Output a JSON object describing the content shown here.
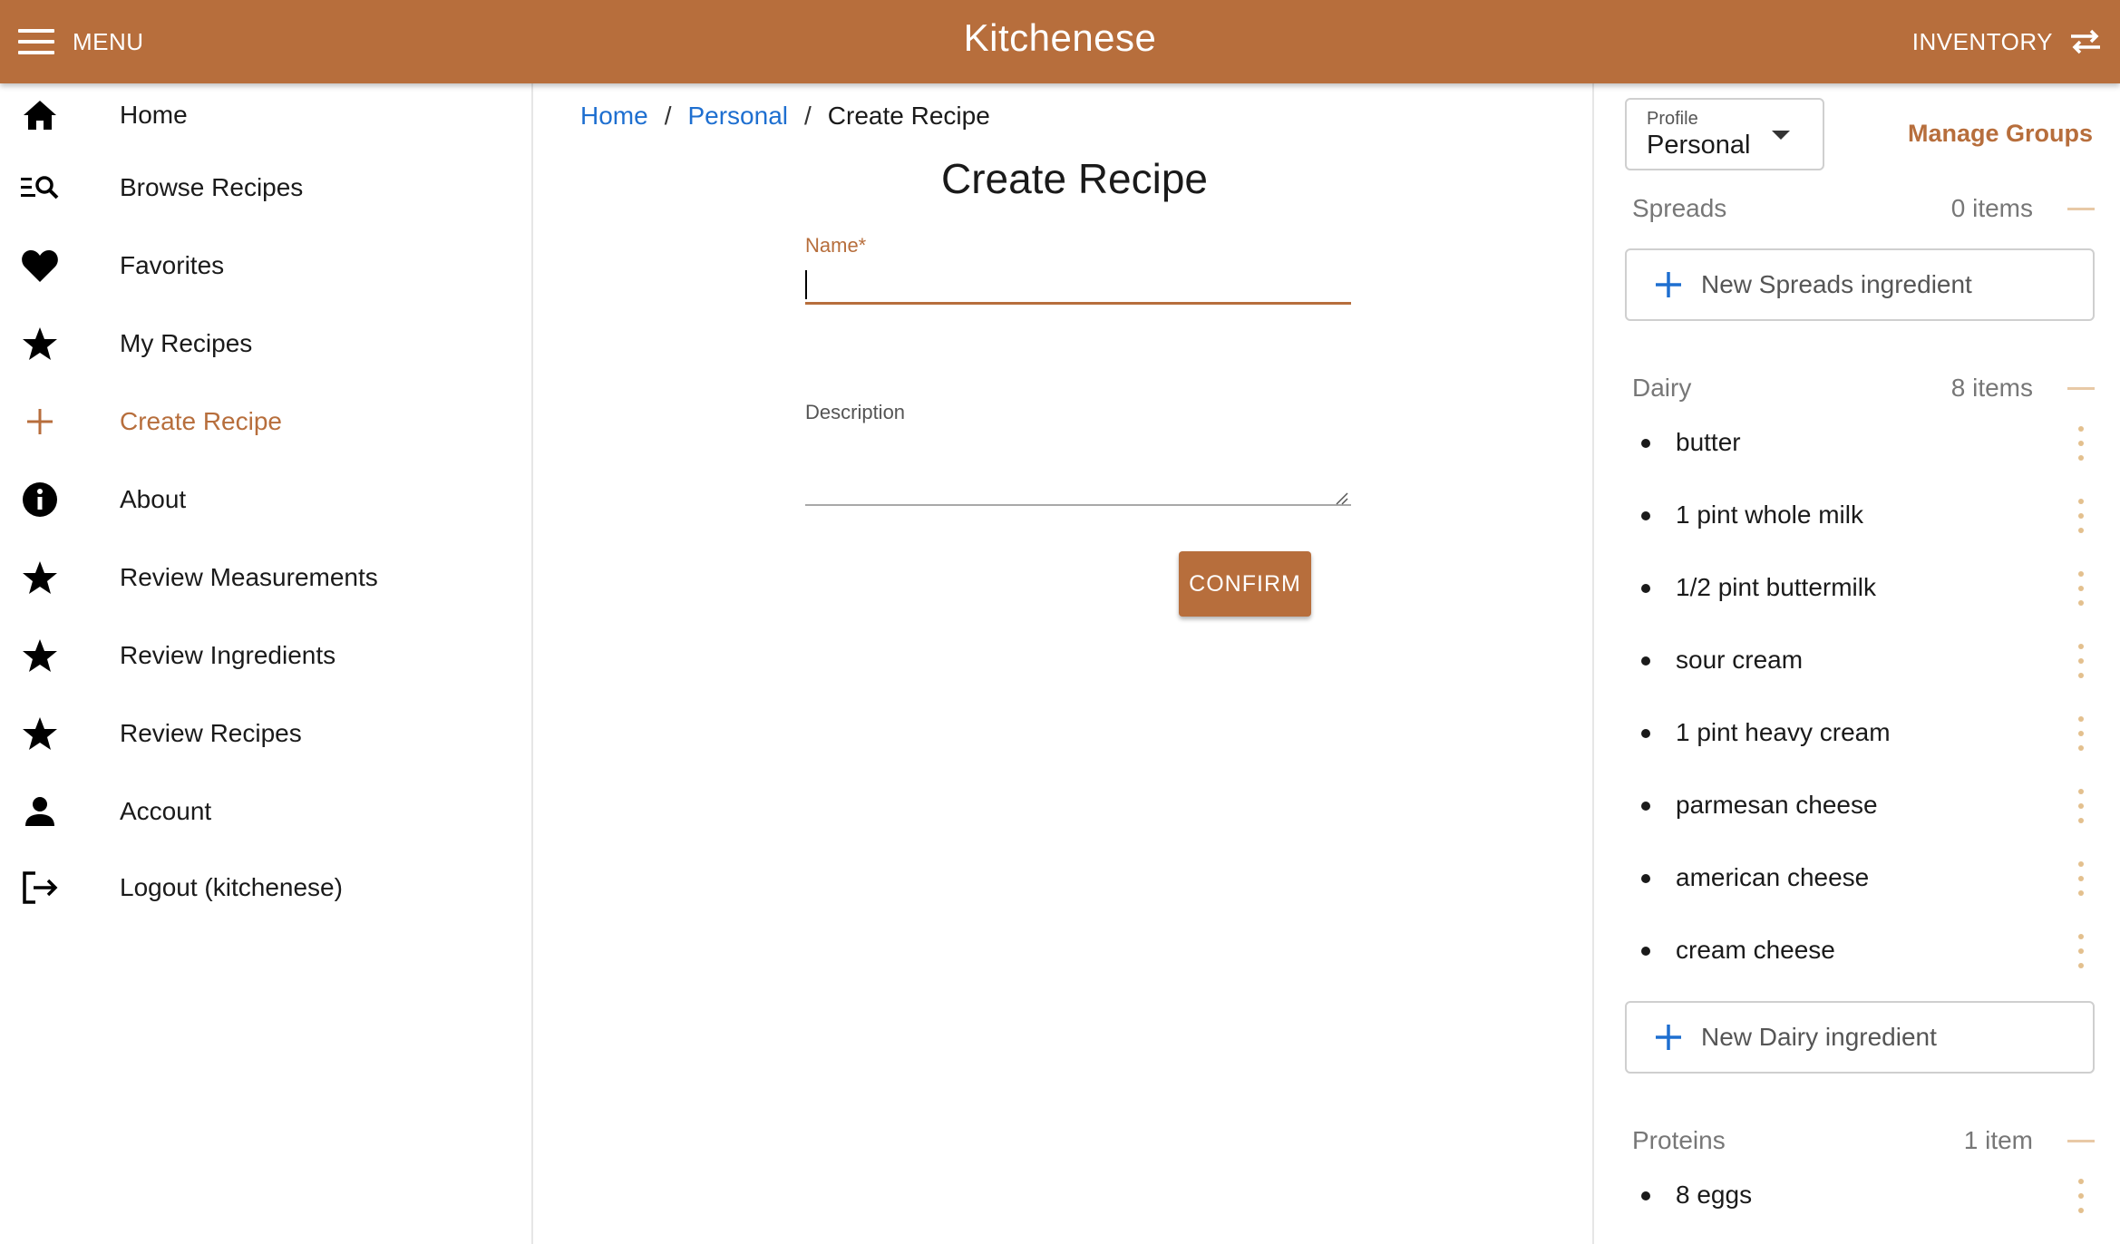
{
  "header": {
    "menu_label": "MENU",
    "app_title": "Kitchenese",
    "inventory_label": "INVENTORY"
  },
  "sidebar": {
    "items": [
      {
        "label": "Home",
        "icon": "home-icon"
      },
      {
        "label": "Browse Recipes",
        "icon": "browse-search-icon"
      },
      {
        "label": "Favorites",
        "icon": "heart-icon"
      },
      {
        "label": "My Recipes",
        "icon": "star-icon"
      },
      {
        "label": "Create Recipe",
        "icon": "plus-icon",
        "active": true
      },
      {
        "label": "About",
        "icon": "info-icon"
      },
      {
        "label": "Review Measurements",
        "icon": "star-icon"
      },
      {
        "label": "Review Ingredients",
        "icon": "star-icon"
      },
      {
        "label": "Review Recipes",
        "icon": "star-icon"
      },
      {
        "label": "Account",
        "icon": "person-icon"
      },
      {
        "label": "Logout (kitchenese)",
        "icon": "logout-icon"
      }
    ]
  },
  "breadcrumb": {
    "home": "Home",
    "personal": "Personal",
    "current": "Create Recipe",
    "separator": "/"
  },
  "form": {
    "title": "Create Recipe",
    "name_label": "Name*",
    "name_value": "",
    "description_label": "Description",
    "description_value": "",
    "confirm_label": "CONFIRM"
  },
  "inventory": {
    "profile_label": "Profile",
    "profile_value": "Personal",
    "manage_groups_label": "Manage Groups",
    "groups": [
      {
        "name": "Spreads",
        "count": "0 items",
        "new_label": "New Spreads ingredient",
        "items": []
      },
      {
        "name": "Dairy",
        "count": "8 items",
        "new_label": "New Dairy ingredient",
        "items": [
          "butter",
          "1 pint whole milk",
          "1/2 pint buttermilk",
          "sour cream",
          "1 pint heavy cream",
          "parmesan cheese",
          "american cheese",
          "cream cheese"
        ]
      },
      {
        "name": "Proteins",
        "count": "1 item",
        "items": [
          "8 eggs"
        ]
      }
    ]
  },
  "colors": {
    "brand": "#b76e3c",
    "link": "#1e6fd0",
    "kebab": "#e3c08e"
  }
}
